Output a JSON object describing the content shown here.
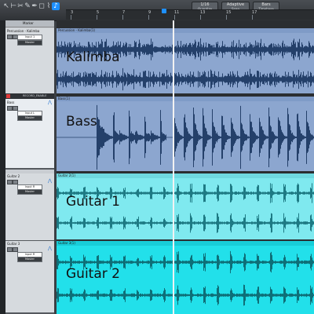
{
  "toolbar": {
    "tools": [
      {
        "name": "arrow-tool-icon",
        "glyph": "↖",
        "active": false
      },
      {
        "name": "range-tool-icon",
        "glyph": "⊢",
        "active": false
      },
      {
        "name": "split-tool-icon",
        "glyph": "✂",
        "active": false
      },
      {
        "name": "eraser-tool-icon",
        "glyph": "✎",
        "active": false
      },
      {
        "name": "paint-tool-icon",
        "glyph": "✒",
        "active": false
      },
      {
        "name": "mute-tool-icon",
        "glyph": "◻",
        "active": false
      },
      {
        "name": "bend-tool-icon",
        "glyph": "⌇",
        "active": false
      },
      {
        "name": "listen-tool-icon",
        "glyph": "♪",
        "active": true
      }
    ],
    "snap_value": "1/16",
    "snap_sub": "Quantize",
    "mode_value": "Adaptive",
    "mode_sub": "Snap",
    "timebase_value": "Bars",
    "timebase_sub": "Timebase",
    "ruler_ticks": [
      "3",
      "5",
      "7",
      "9",
      "11",
      "13",
      "15",
      "17"
    ]
  },
  "tracks": [
    {
      "name": "Percussion - Kalimba",
      "header_name": "Percussion - Kalimba",
      "input": "Input 1",
      "output": "Master",
      "clip_name": "Percussion - Kalimba(1)",
      "label": "Kalimba",
      "clip_color": "#8ca6cf",
      "header_color": "#7f9bc7",
      "wave_color": "#24406a"
    },
    {
      "name": "Bass",
      "header_name": "Bass",
      "input": "Input L",
      "output": "Master",
      "clip_name": "Bass(1)",
      "label": "Bass",
      "clip_color": "#8ca6cf",
      "header_color": "#7f9bc7",
      "wave_color": "#24406a"
    },
    {
      "name": "Guitar 2",
      "header_name": "Guitar 2",
      "input": "Input R",
      "output": "Master",
      "clip_name": "Guitar 2(1)",
      "label": "Guitar 1",
      "clip_color": "#7fe9ef",
      "header_color": "#6fd9e0",
      "wave_color": "#1e7a84"
    },
    {
      "name": "Guitar 3",
      "header_name": "Guitar 3",
      "input": "Input R",
      "output": "Master",
      "clip_name": "Guitar 3(1)",
      "label": "Guitar 2",
      "clip_color": "#22e0ea",
      "header_color": "#18cdd8",
      "wave_color": "#0e6f78"
    }
  ],
  "marker_track": {
    "name": "Marker"
  },
  "record_button_label": "RECORD_ENABLE"
}
